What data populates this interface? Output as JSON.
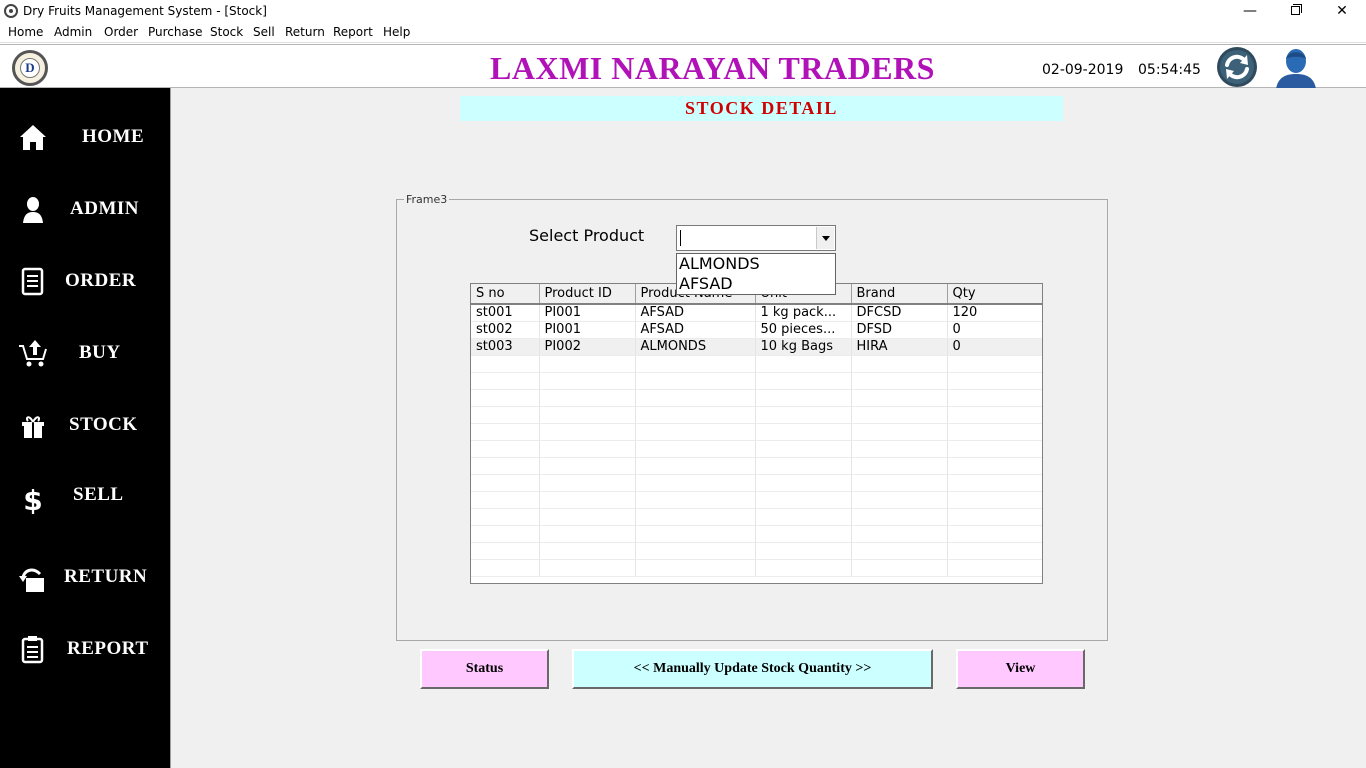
{
  "window": {
    "title": "Dry Fruits Management System - [Stock]",
    "minimize_glyph": "—",
    "close_glyph": "✕"
  },
  "menu": [
    "Home",
    "Admin",
    "Order",
    "Purchase",
    "Stock",
    "Sell",
    "Return",
    "Report",
    "Help"
  ],
  "header": {
    "logo_letter": "D",
    "company": "LAXMI NARAYAN TRADERS",
    "date": "02-09-2019",
    "time": "05:54:45"
  },
  "sidebar": [
    {
      "label": "HOME",
      "icon": "home-icon"
    },
    {
      "label": "ADMIN",
      "icon": "admin-icon"
    },
    {
      "label": "ORDER",
      "icon": "order-icon"
    },
    {
      "label": "BUY",
      "icon": "cart-icon"
    },
    {
      "label": "STOCK",
      "icon": "stock-icon"
    },
    {
      "label": "SELL",
      "icon": "dollar-icon"
    },
    {
      "label": "RETURN",
      "icon": "return-icon"
    },
    {
      "label": "REPORT",
      "icon": "report-icon"
    }
  ],
  "page": {
    "title": "STOCK  DETAIL",
    "frame_label": "Frame3",
    "select_label": "Select Product",
    "select_value": "",
    "dropdown_options": [
      "ALMONDS",
      "AFSAD"
    ]
  },
  "table": {
    "columns": [
      "S no",
      "Product ID",
      "Product Name",
      "Unit",
      "Brand",
      "Qty"
    ],
    "rows": [
      [
        "st001",
        "PI001",
        "AFSAD",
        "1 kg pack...",
        "DFCSD",
        "120"
      ],
      [
        "st002",
        "PI001",
        "AFSAD",
        "50 pieces...",
        "DFSD",
        "0"
      ],
      [
        "st003",
        "PI002",
        "ALMONDS",
        "10 kg Bags",
        "HIRA",
        "0"
      ]
    ]
  },
  "buttons": {
    "status": "Status",
    "update": "<<  Manually Update Stock Quantity  >>",
    "view": "View"
  },
  "colors": {
    "company": "#b012b8",
    "page_title": "#d00000",
    "title_bg": "#ccffff",
    "pink_button": "#ffc8ff",
    "cyan_button": "#ccffff",
    "sidebar_bg": "#000000"
  }
}
